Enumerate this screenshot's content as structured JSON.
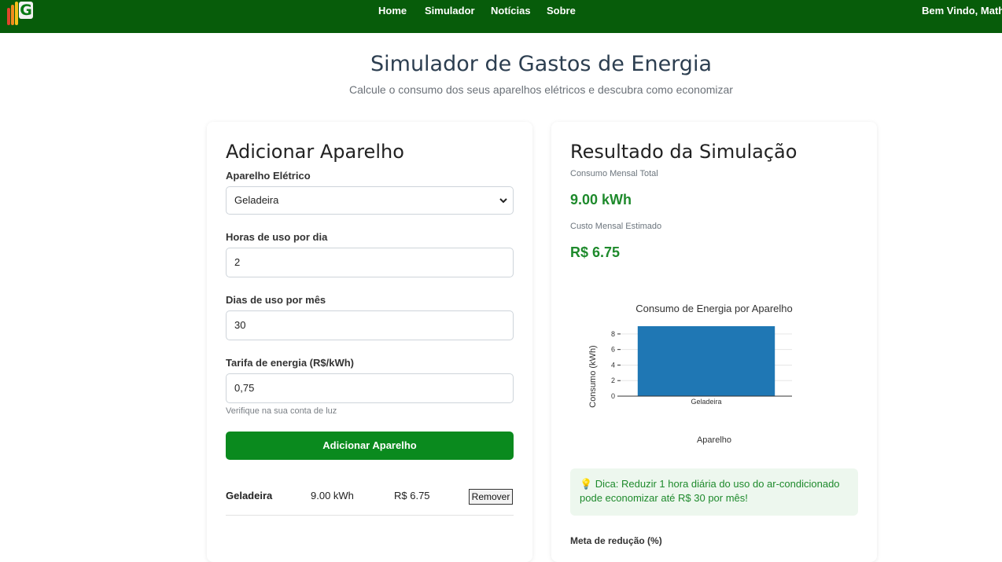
{
  "navbar": {
    "logo_letter": "G",
    "links": [
      "Home",
      "Simulador",
      "Notícias",
      "Sobre"
    ],
    "welcome": "Bem Vindo, Mathe",
    "bg_color": "#075c0a"
  },
  "header": {
    "title": "Simulador de Gastos de Energia",
    "subtitle": "Calcule o consumo dos seus aparelhos elétricos e descubra como economizar"
  },
  "form": {
    "title": "Adicionar Aparelho",
    "appliance_label": "Aparelho Elétrico",
    "appliance_value": "Geladeira",
    "hours_label": "Horas de uso por dia",
    "hours_value": "2",
    "days_label": "Dias de uso por mês",
    "days_value": "30",
    "tariff_label": "Tarifa de energia (R$/kWh)",
    "tariff_value": "0,75",
    "tariff_hint": "Verifique na sua conta de luz",
    "add_button": "Adicionar Aparelho"
  },
  "appliances": [
    {
      "name": "Geladeira",
      "consumption": "9.00 kWh",
      "cost": "R$ 6.75",
      "remove_label": "Remover"
    }
  ],
  "result": {
    "title": "Resultado da Simulação",
    "total_label": "Consumo Mensal Total",
    "total_value": "9.00 kWh",
    "cost_label": "Custo Mensal Estimado",
    "cost_value": "R$ 6.75",
    "tip": "💡 Dica: Reduzir 1 hora diária do uso do ar-condicionado pode economizar até R$ 30 por mês!",
    "meta_label": "Meta de redução (%)",
    "accent_color": "#1e8a2c"
  },
  "chart_data": {
    "type": "bar",
    "title": "Consumo de Energia por Aparelho",
    "xlabel": "Aparelho",
    "ylabel": "Consumo (kWh)",
    "categories": [
      "Geladeira"
    ],
    "values": [
      9
    ],
    "ylim": [
      0,
      9
    ],
    "yticks": [
      0,
      2,
      4,
      6,
      8
    ],
    "bar_color": "#1f77b4",
    "grid": true
  }
}
